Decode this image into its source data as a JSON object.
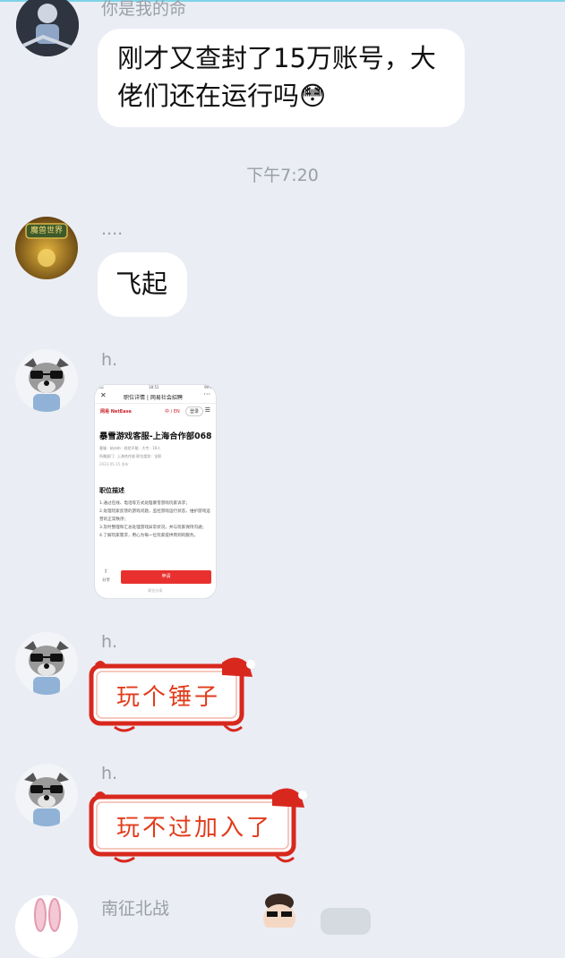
{
  "messages": [
    {
      "sender": "你是我的命",
      "text": "刚才又查封了15万账号，大佬们还在运行吗",
      "emoji": "😳"
    },
    {
      "time": "下午7:20"
    },
    {
      "sender": "....",
      "text": "飞起",
      "avatar_text": "魔兽世界"
    },
    {
      "sender": "h.",
      "screenshot": {
        "status_time": "18:51",
        "status_left": "4G",
        "status_right": "99%",
        "nav_title": "职位详情 | 网易社会招聘",
        "brand": "网易 NetEase",
        "lang": "中 / EN",
        "login": "登录",
        "job_title": "暴雪游戏客服-上海合作部068",
        "meta1": "客服 · 杭州市 · 经验不限 · 大专 · 10人",
        "meta2": "所属部门：上海合作部   职位类别：全职",
        "date": "2023-05-15 发布",
        "section_title": "职位描述",
        "desc": [
          "1.通过在线、电话等方式处理暴雪游戏玩家诉求；",
          "2.处理玩家反馈的游戏问题，监控游戏运行状态，维护游戏运营的正常秩序；",
          "3.及时整理和汇总处理游戏异常状况，并与玩家保持沟通；",
          "4.了解玩家需求，用心为每一位玩家提供周到的服务。"
        ],
        "share": "分享",
        "apply": "申请",
        "footer": "职位分享"
      }
    },
    {
      "sender": "h.",
      "sticker": "玩个锤子"
    },
    {
      "sender": "h.",
      "sticker": "玩不过加入了"
    },
    {
      "sender": "南征北战"
    }
  ],
  "colors": {
    "background": "#eaedf4",
    "bubble": "#ffffff",
    "sticker_red": "#e23b1b",
    "apply_red": "#e8312e"
  }
}
